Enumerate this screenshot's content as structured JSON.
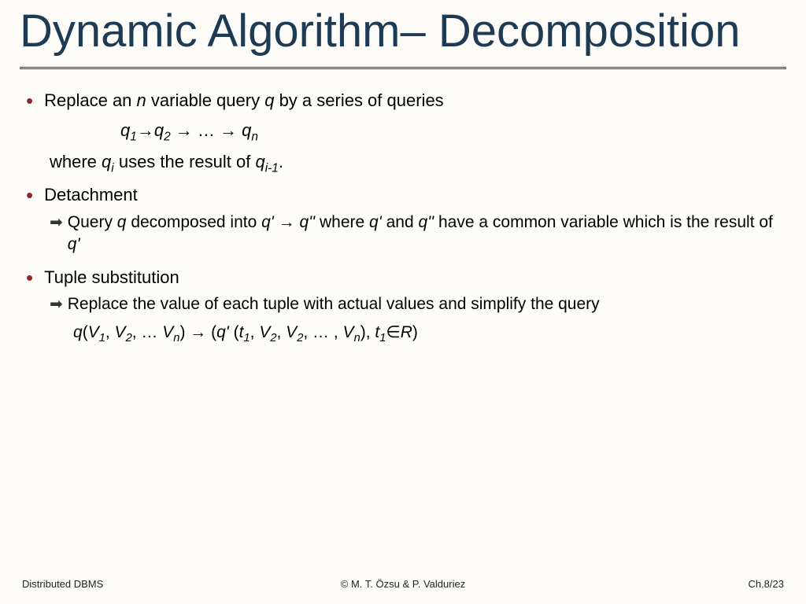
{
  "title": "Dynamic Algorithm– Decomposition",
  "bullets": {
    "b1_pre": "Replace an ",
    "b1_n": "n",
    "b1_mid": " variable query ",
    "b1_q": "q",
    "b1_post": " by a series of queries",
    "formula1_q1": "q",
    "formula1_s1": "1",
    "formula1_arrow1": "→",
    "formula1_q2": "q",
    "formula1_s2": "2",
    "formula1_arrow2": " → … → ",
    "formula1_qn": "q",
    "formula1_sn": "n",
    "b1_where_pre": "where ",
    "b1_where_qi": "q",
    "b1_where_si": "i",
    "b1_where_mid": " uses the result of ",
    "b1_where_qi1": "q",
    "b1_where_si1": "i-1",
    "b1_where_post": ".",
    "b2": "Detachment",
    "b2_sub_pre": "Query ",
    "b2_sub_q": "q",
    "b2_sub_mid1": " decomposed into ",
    "b2_sub_qp": "q'",
    "b2_sub_arrow": " → ",
    "b2_sub_qpp": "q''",
    "b2_sub_mid2": " where ",
    "b2_sub_qp2": "q'",
    "b2_sub_mid3": " and ",
    "b2_sub_qpp2": "q''",
    "b2_sub_mid4": " have a common variable which is the result of ",
    "b2_sub_qp3": "q'",
    "b3": "Tuple substitution",
    "b3_sub": "Replace the value of each tuple with actual values and simplify the query",
    "b3_formula": "q(V₁, V₂, … Vₙ) → (q' (t₁, V₂, V₂, … , Vₙ), t₁∈R)"
  },
  "footer": {
    "left": "Distributed DBMS",
    "center": "© M. T. Özsu & P. Valduriez",
    "right": "Ch.8/23"
  }
}
